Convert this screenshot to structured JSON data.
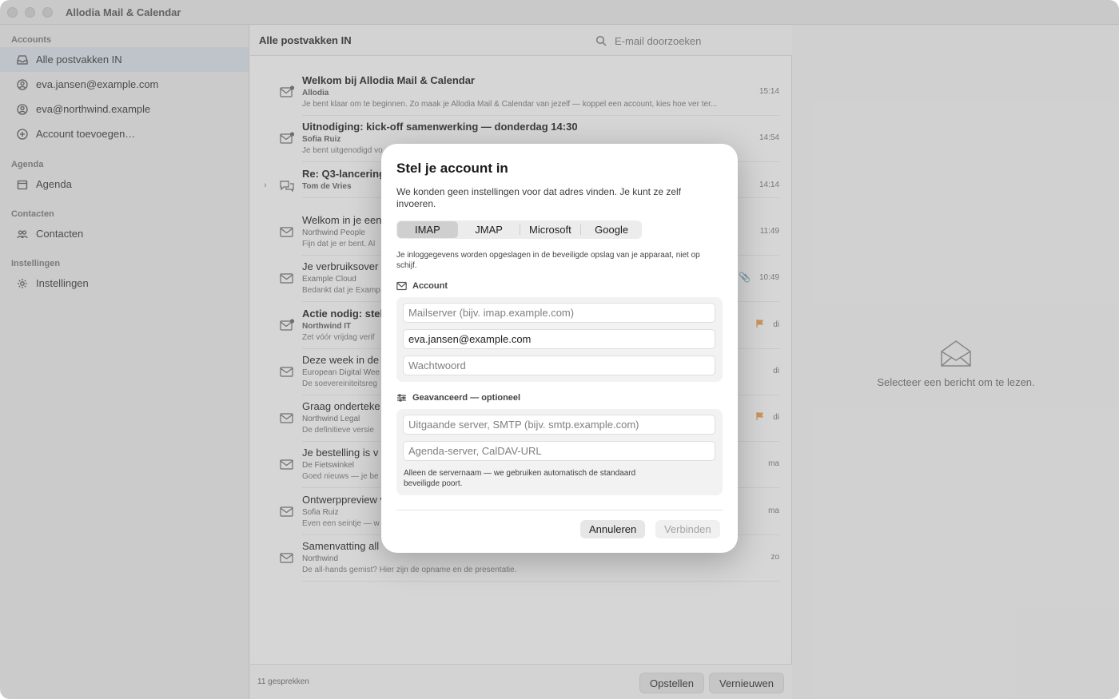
{
  "window": {
    "title": "Allodia Mail & Calendar"
  },
  "sidebar": {
    "sections": [
      {
        "label": "Accounts"
      },
      {
        "label": "Agenda"
      },
      {
        "label": "Contacten"
      },
      {
        "label": "Instellingen"
      }
    ],
    "items": [
      {
        "label": "Alle postvakken IN",
        "icon": "inbox-icon",
        "selected": true
      },
      {
        "label": "eva.jansen@example.com",
        "icon": "account-icon"
      },
      {
        "label": "eva@northwind.example",
        "icon": "account-icon"
      },
      {
        "label": "Account toevoegen…",
        "icon": "plus-circle-icon"
      },
      {
        "label": "Agenda",
        "icon": "calendar-icon"
      },
      {
        "label": "Contacten",
        "icon": "people-icon"
      },
      {
        "label": "Instellingen",
        "icon": "gear-icon"
      }
    ]
  },
  "list": {
    "title": "Alle postvakken IN",
    "search_placeholder": "E-mail doorzoeken",
    "messages": [
      {
        "subject": "Welkom bij Allodia Mail & Calendar",
        "from": "Allodia",
        "preview": "Je bent klaar om te beginnen. Zo maak je Allodia Mail & Calendar van jezelf — koppel een account, kies hoe ver ter...",
        "time": "15:14",
        "unread": true
      },
      {
        "subject": "Uitnodiging: kick-off samenwerking — donderdag 14:30",
        "from": "Sofia Ruiz",
        "preview": "Je bent uitgenodigd vo",
        "time": "14:54",
        "unread": true
      },
      {
        "subject": "Re: Q3-lancering",
        "from": "Tom de Vries",
        "preview": "",
        "time": "14:14",
        "unread": true,
        "thread": true
      },
      {
        "subject": "Welkom in je een",
        "from": "Northwind People",
        "preview": "Fijn dat je er bent. Al",
        "time": "11:49"
      },
      {
        "subject": "Je verbruiksover",
        "from": "Example Cloud",
        "preview": "Bedankt dat je Examp",
        "time": "10:49",
        "attachment": true
      },
      {
        "subject": "Actie nodig: stel",
        "from": "Northwind IT",
        "preview": "Zet vóór vrijdag verif",
        "time": "di",
        "unread": true,
        "flagged": true
      },
      {
        "subject": "Deze week in de",
        "from": "European Digital Wee",
        "preview": "De soevereiniteitsreg",
        "time": "di"
      },
      {
        "subject": "Graag onderteke",
        "from": "Northwind Legal",
        "preview": "De definitieve versie",
        "time": "di",
        "flagged": true
      },
      {
        "subject": "Je bestelling is v",
        "from": "De Fietswinkel",
        "preview": "Goed nieuws — je be",
        "time": "ma"
      },
      {
        "subject": "Ontwerppreview v",
        "from": "Sofia Ruiz",
        "preview": "Even een seintje — w",
        "time": "ma"
      },
      {
        "subject": "Samenvatting all",
        "from": "Northwind",
        "preview": "De all-hands gemist? Hier zijn de opname en de presentatie.",
        "time": "zo"
      }
    ],
    "footer": {
      "count": "11 gesprekken",
      "compose_label": "Opstellen",
      "refresh_label": "Vernieuwen"
    }
  },
  "reader": {
    "empty_text": "Selecteer een bericht om te lezen."
  },
  "modal": {
    "title": "Stel je account in",
    "description": "We konden geen instellingen voor dat adres vinden. Je kunt ze zelf invoeren.",
    "tabs": [
      {
        "label": "IMAP",
        "active": true
      },
      {
        "label": "JMAP"
      },
      {
        "label": "Microsoft"
      },
      {
        "label": "Google"
      }
    ],
    "storage_note": "Je inloggegevens worden opgeslagen in de beveiligde opslag van je apparaat, niet op schijf.",
    "account_section": {
      "label": "Account",
      "fields": {
        "server": {
          "value": "",
          "placeholder": "Mailserver (bijv. imap.example.com)"
        },
        "email": {
          "value": "eva.jansen@example.com",
          "placeholder": ""
        },
        "password": {
          "value": "",
          "placeholder": "Wachtwoord"
        }
      }
    },
    "advanced_section": {
      "label": "Geavanceerd — optioneel",
      "fields": {
        "smtp": {
          "value": "",
          "placeholder": "Uitgaande server, SMTP (bijv. smtp.example.com)"
        },
        "caldav": {
          "value": "",
          "placeholder": "Agenda-server, CalDAV-URL"
        }
      },
      "note": "Alleen de servernaam — we gebruiken automatisch de standaard beveiligde poort."
    },
    "cancel_label": "Annuleren",
    "connect_label": "Verbinden"
  },
  "colors": {
    "flag": "#f0a050",
    "selection": "#dde5ee",
    "overlay": "rgba(120,120,120,0.30)"
  }
}
